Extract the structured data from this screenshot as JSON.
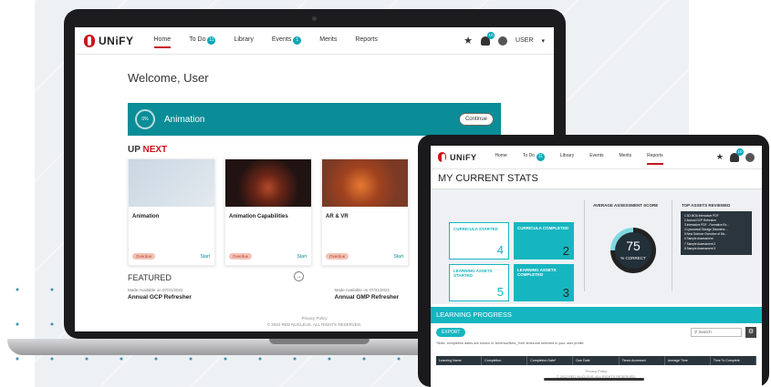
{
  "laptop": {
    "brand": "UNiFY",
    "nav": [
      {
        "label": "Home",
        "badge": ""
      },
      {
        "label": "To Do",
        "badge": "11"
      },
      {
        "label": "Library",
        "badge": ""
      },
      {
        "label": "Events",
        "badge": "1"
      },
      {
        "label": "Merits",
        "badge": ""
      },
      {
        "label": "Reports",
        "badge": ""
      }
    ],
    "bell_badge": "10",
    "user_label": "USER",
    "welcome": "Welcome, User",
    "banner": {
      "percent": "0%",
      "title": "Animation",
      "continue": "Continue"
    },
    "upnext": {
      "prefix": "UP ",
      "accent": "NEXT"
    },
    "cards": [
      {
        "title": "Animation",
        "tag": "Overdue",
        "action": "Start"
      },
      {
        "title": "Animation Capabilities",
        "tag": "Overdue",
        "action": "Start"
      },
      {
        "title": "AR & VR",
        "tag": "Overdue",
        "action": "Start"
      }
    ],
    "featured_title": "FEATURED",
    "featured": [
      {
        "avail": "Made Available on 07/31/2022",
        "name": "Annual GCP Refresher"
      },
      {
        "avail": "Made Available on 07/31/2022",
        "name": "Annual GMP Refresher"
      }
    ],
    "footer_link": "Privacy Policy",
    "footer_copy": "© 2022 RED NUCLEUS. ALL RIGHTS RESERVED."
  },
  "tablet": {
    "brand": "UNiFY",
    "nav": [
      {
        "label": "Home",
        "badge": ""
      },
      {
        "label": "To Do",
        "badge": "11"
      },
      {
        "label": "Library",
        "badge": ""
      },
      {
        "label": "Events",
        "badge": ""
      },
      {
        "label": "Merits",
        "badge": ""
      },
      {
        "label": "Reports",
        "badge": ""
      }
    ],
    "bell_badge": "10",
    "stats_title": "MY CURRENT STATS",
    "stats": [
      {
        "label": "CURRICULA STARTED",
        "value": "4"
      },
      {
        "label": "CURRICULA COMPLETED",
        "value": "2"
      },
      {
        "label": "LEARNING ASSETS STARTED",
        "value": "5"
      },
      {
        "label": "LEARNING ASSETS COMPLETED",
        "value": "3"
      }
    ],
    "avg_label": "AVERAGE ASSESSMENT SCORE",
    "avg_value": "75",
    "avg_unit": "% CORRECT",
    "avg_fraction": 0.75,
    "top_label": "TOP ASSETS REVIEWED",
    "top_assets": [
      "1  3D MOA Interactive PDF",
      "2  Annual GCP Refresher",
      "3  Interactive PDF - Formative Ex...",
      "4  Lysosomal Storage Disorders ...",
      "5  New Science Overview of Mo...",
      "6  Sample Assessment",
      "7  Sample Assessment 2",
      "8  Sample Assessment 3"
    ],
    "lp_title": "LEARNING PROGRESS",
    "export": "EXPORT",
    "search_placeholder": "Search",
    "note": "*Note: completion dates are shown in 'America/New_York' timezone selected in your user profile.",
    "columns": [
      "Learning Name",
      "Completion",
      "Completion Date*",
      "Due Date",
      "Times Accessed",
      "Average Time",
      "Time To Complete"
    ],
    "footer_link": "Privacy Policy",
    "footer_copy": "© 2022 RED NUCLEUS. ALL RIGHTS RESERVED."
  }
}
